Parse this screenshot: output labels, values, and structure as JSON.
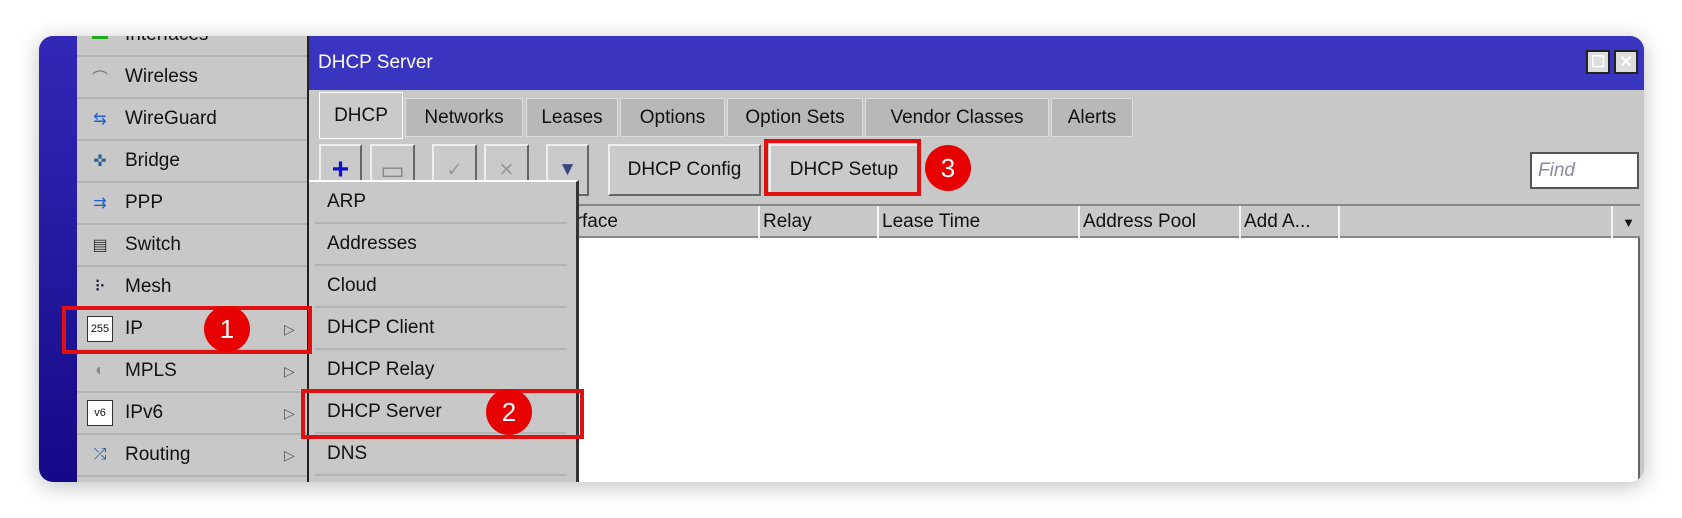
{
  "sidebar": {
    "items": [
      {
        "label": "Interfaces",
        "icon": "interfaces-icon"
      },
      {
        "label": "Wireless",
        "icon": "wireless-icon"
      },
      {
        "label": "WireGuard",
        "icon": "wireguard-icon"
      },
      {
        "label": "Bridge",
        "icon": "bridge-icon"
      },
      {
        "label": "PPP",
        "icon": "ppp-icon"
      },
      {
        "label": "Switch",
        "icon": "switch-icon"
      },
      {
        "label": "Mesh",
        "icon": "mesh-icon"
      },
      {
        "label": "IP",
        "icon": "ip-icon",
        "submenu": true
      },
      {
        "label": "MPLS",
        "icon": "mpls-icon",
        "submenu": true
      },
      {
        "label": "IPv6",
        "icon": "ipv6-icon",
        "submenu": true
      },
      {
        "label": "Routing",
        "icon": "routing-icon",
        "submenu": true
      }
    ]
  },
  "submenu": {
    "items": [
      "ARP",
      "Addresses",
      "Cloud",
      "DHCP Client",
      "DHCP Relay",
      "DHCP Server",
      "DNS"
    ]
  },
  "window": {
    "title": "DHCP Server",
    "tabs": [
      "DHCP",
      "Networks",
      "Leases",
      "Options",
      "Option Sets",
      "Vendor Classes",
      "Alerts"
    ],
    "active_tab": "DHCP",
    "toolbar": {
      "config_label": "DHCP Config",
      "setup_label": "DHCP Setup"
    },
    "find_placeholder": "Find",
    "columns": [
      "Interface",
      "Relay",
      "Lease Time",
      "Address Pool",
      "Add A..."
    ]
  },
  "annotations": [
    "1",
    "2",
    "3"
  ],
  "colors": {
    "title_bar": "#3a35c0",
    "highlight": "#e01010"
  }
}
